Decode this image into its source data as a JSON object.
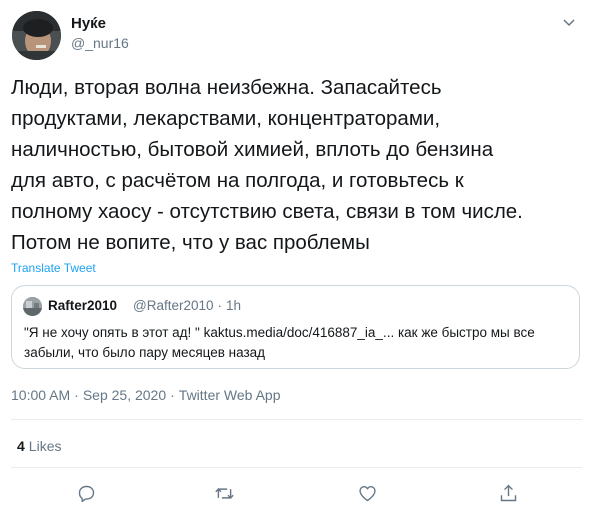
{
  "tweet": {
    "display_name": "Нуќе",
    "handle": "@_nur16",
    "text": "Люди, вторая волна неизбежна. Запасайтесь\nпродуктами, лекарствами, концентраторами,\nналичностью, бытовой химией, вплоть до бензина\nдля авто, с расчётом на полгода, и готовьтесь к\nполному хаосу - отсутствию света, связи в том числе.\nПотом не вопите, что у вас проблемы",
    "translate_label": "Translate Tweet",
    "time": "10:00 AM",
    "date": "Sep 25, 2020",
    "source": "Twitter Web App",
    "separator": "·",
    "likes_count": "4",
    "likes_label": "Likes"
  },
  "quote": {
    "display_name": "Rafter2010",
    "handle": "@Rafter2010",
    "separator": "·",
    "age": "1h",
    "text": "\"Я не хочу опять в этот ад! \" kaktus.media/doc/416887_ia_... как же быстро мы все забыли, что было пару месяцев назад"
  },
  "icons": {
    "caret": "chevron-down-icon",
    "reply": "reply-icon",
    "retweet": "retweet-icon",
    "like": "heart-icon",
    "share": "share-icon"
  },
  "colors": {
    "link": "#1da1f2",
    "secondary_text": "#657786",
    "border": "#ccd6dd"
  }
}
